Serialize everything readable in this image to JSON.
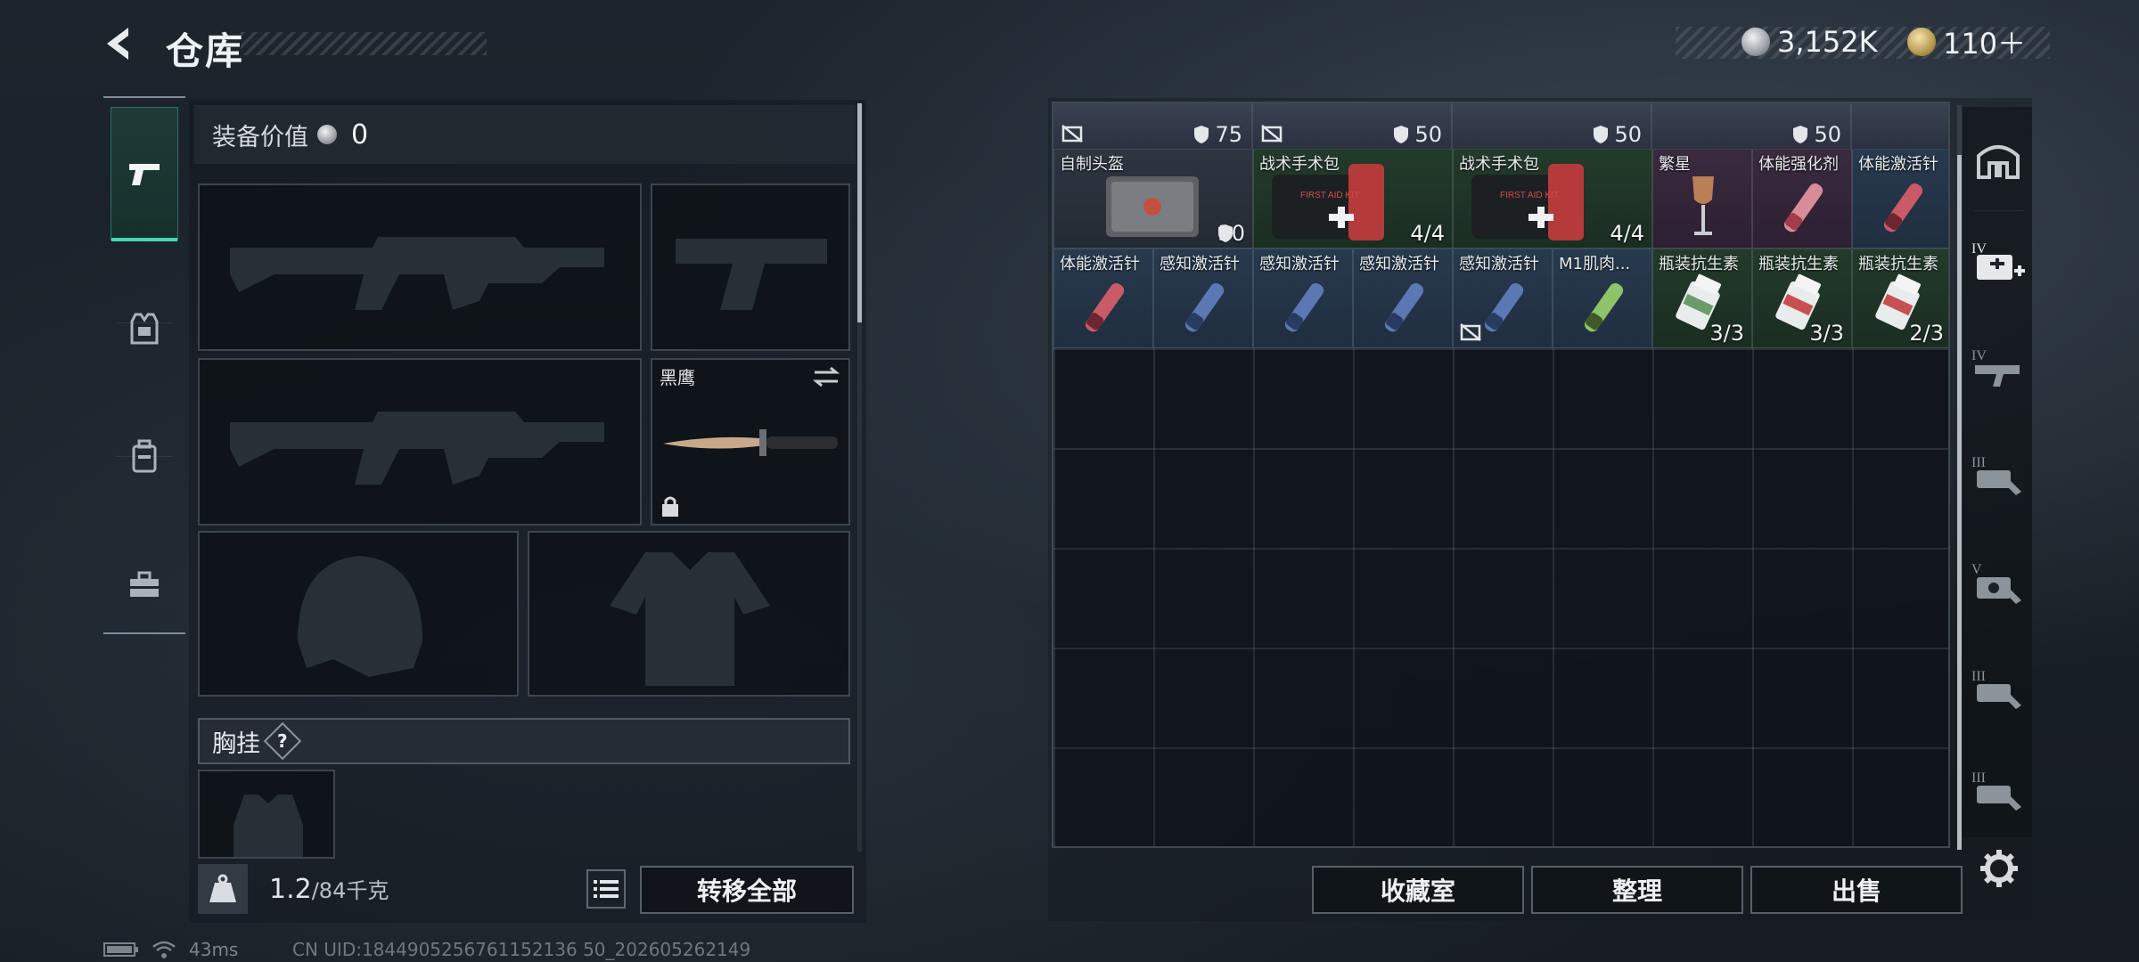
{
  "header": {
    "title": "仓库"
  },
  "currencies": {
    "silver": "3,152K",
    "gold": "110＋"
  },
  "equipment": {
    "value_label": "装备价值",
    "value": "0",
    "melee_name": "黑鹰",
    "chest_label": "胸挂",
    "help_symbol": "?",
    "weight_current": "1.2",
    "weight_max": "/84千克",
    "transfer_all_label": "转移全部"
  },
  "storage": {
    "top_strip_numbers": [
      "75",
      "50",
      "50",
      "50"
    ],
    "row1": [
      {
        "name": "自制头盔",
        "count": "30"
      },
      {
        "name": "战术手术包",
        "count": "4/4"
      },
      {
        "name": "战术手术包",
        "count": "4/4"
      },
      {
        "name": "繁星",
        "count": ""
      },
      {
        "name": "体能强化剂",
        "count": ""
      },
      {
        "name": "体能激活针",
        "count": ""
      }
    ],
    "row2": [
      {
        "name": "体能激活针",
        "count": ""
      },
      {
        "name": "感知激活针",
        "count": ""
      },
      {
        "name": "感知激活针",
        "count": ""
      },
      {
        "name": "感知激活针",
        "count": ""
      },
      {
        "name": "感知激活针",
        "count": ""
      },
      {
        "name": "M1肌肉...",
        "count": ""
      },
      {
        "name": "瓶装抗生素",
        "count": "3/3"
      },
      {
        "name": "瓶装抗生素",
        "count": "3/3"
      },
      {
        "name": "瓶装抗生素",
        "count": "2/3"
      }
    ],
    "buttons": {
      "collection": "收藏室",
      "organize": "整理",
      "sell": "出售"
    }
  },
  "rail_filters": [
    "IV",
    "IV",
    "III",
    "V",
    "III",
    "III"
  ],
  "status": {
    "ping": "43ms",
    "uid": "CN UID:1844905256761152136 50_202605262149"
  },
  "colors": {
    "accent": "#49d6b4",
    "quality_gray": "#2d3641",
    "quality_green": "#233b2b",
    "quality_purple": "#3b2a40",
    "quality_blue": "#283a4f"
  }
}
